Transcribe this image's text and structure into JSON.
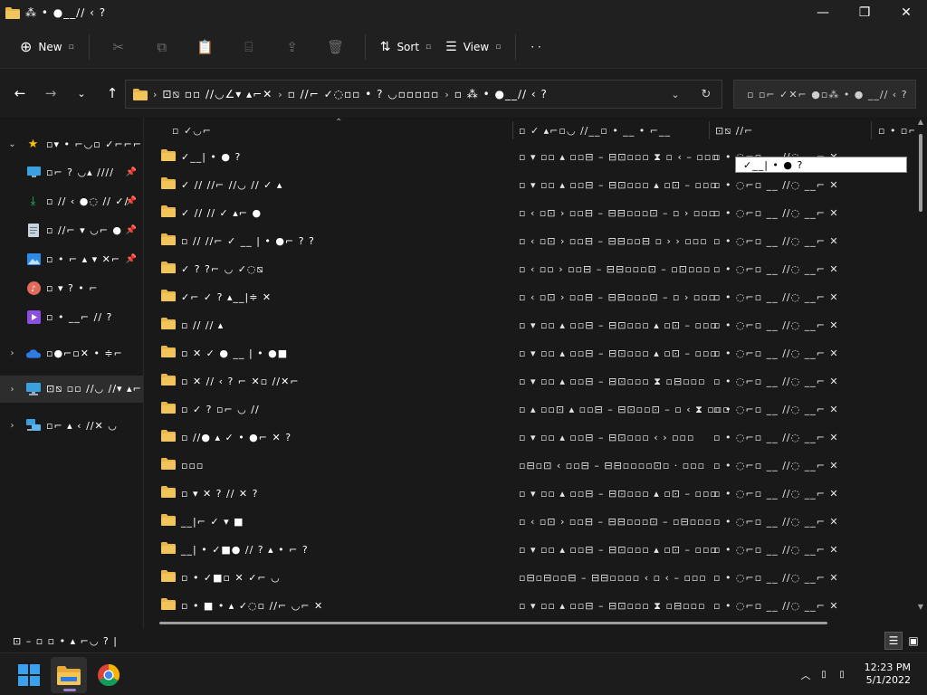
{
  "window": {
    "title": "⁂ • ●__∕∕ ‹ ?",
    "controls": {
      "minimize": "—",
      "maximize": "❐",
      "close": "✕"
    }
  },
  "commandbar": {
    "new_label": "New",
    "sort_label": "Sort",
    "view_label": "View",
    "more_label": "· ·"
  },
  "address": {
    "crumbs": [
      "⊡⧅ ▫▫ ∕∕◡∠▾ ▴⌐✕",
      "▫ ∕∕⌐ ✓◌▫▫ • ? ◡▫▫▫▫▫",
      "▫ ⁂ • ●__∕∕ ‹ ?"
    ],
    "search_placeholder": "▫  ▫⌐ ✓✕⌐ ●▫⁂ • ● __∕∕ ‹ ?"
  },
  "nav": {
    "items": [
      {
        "label": "▫▾ • ⌐◡▫ ✓⌐⌐⌐",
        "icon": "star-icon",
        "chevron": "expanded",
        "pinned": false,
        "selected": false
      },
      {
        "label": "▫⌐ ? ◡▴ ∕∕∕∕",
        "icon": "desktop-icon",
        "chevron": "",
        "pinned": true,
        "selected": false
      },
      {
        "label": "▫ ∕∕ ‹ ●◌ ∕∕ ✓∕",
        "icon": "download-icon",
        "chevron": "",
        "pinned": true,
        "selected": false
      },
      {
        "label": "▫ ∕∕⌐ ▾ ◡⌐ ●",
        "icon": "document-icon",
        "chevron": "",
        "pinned": true,
        "selected": false
      },
      {
        "label": "▫ • ⌐ ▴ ▾ ✕⌐",
        "icon": "pictures-icon",
        "chevron": "",
        "pinned": true,
        "selected": false
      },
      {
        "label": "▫ ▾ ? • ⌐",
        "icon": "music-icon",
        "chevron": "",
        "pinned": false,
        "selected": false
      },
      {
        "label": "▫ • __⌐ ∕∕ ?",
        "icon": "videos-icon",
        "chevron": "",
        "pinned": false,
        "selected": false
      },
      {
        "label": "▫●⌐▫✕ • ≑⌐",
        "icon": "onedrive-icon",
        "chevron": "collapsed",
        "pinned": false,
        "selected": false
      },
      {
        "label": "⊡⧅ ▫▫ ∕∕◡ ∕∕▾ ▴⌐",
        "icon": "this-pc-icon",
        "chevron": "collapsed",
        "pinned": false,
        "selected": true
      },
      {
        "label": "▫⌐ ▴ ‹ ∕∕✕ ◡",
        "icon": "network-icon",
        "chevron": "collapsed",
        "pinned": false,
        "selected": false
      }
    ]
  },
  "columns": {
    "name": "▫ ✓◡⌐",
    "date": "▫ ✓ ▴⌐▫◡ ∕∕__▫ • __ • ⌐__",
    "type": "⊡⧅ ∕∕⌐",
    "size": "▫ • ▫⌐"
  },
  "files": [
    {
      "name": "✓__| • ● ?",
      "date": "▫ ▾ ▫▫ ▴ ▫▫⊟ – ⊟⊡▫▫▫ ⧗ ▫ ‹ – ▫▫▫",
      "type": "▫ • ◌⌐▫ __ ∕∕◌ __⌐ ✕"
    },
    {
      "name": "✓ ∕∕ ∕∕⌐ ∕∕◡ ∕∕ ✓ ▴",
      "date": "▫ ▾ ▫▫ ▴ ▫▫⊟ – ⊟⊡▫▫▫ ▴ ▫⊡ – ▫▫▫",
      "type": "▫ • ◌⌐▫ __ ∕∕◌ __⌐ ✕"
    },
    {
      "name": "✓ ∕∕ ∕∕ ✓ ▴⌐ ●",
      "date": "▫ ‹ ▫⊡ › ▫▫⊟ – ⊟⊟▫▫▫⊡ – ▫ › ▫▫▫",
      "type": "▫ • ◌⌐▫ __ ∕∕◌ __⌐ ✕"
    },
    {
      "name": "▫ ∕∕ ∕∕⌐ ✓ __ | • ●⌐ ? ?",
      "date": "▫ ‹ ▫⊡ › ▫▫⊟ – ⊟⊟▫▫⊟ ▫ › › ▫▫▫",
      "type": "▫ • ◌⌐▫ __ ∕∕◌ __⌐ ✕"
    },
    {
      "name": "✓ ? ?⌐ ◡ ✓◌⧅",
      "date": "▫ ‹ ▫▫ › ▫▫⊟ – ⊟⊟▫▫▫⊡ – ▫⊡▫▫▫",
      "type": "▫ • ◌⌐▫ __ ∕∕◌ __⌐ ✕"
    },
    {
      "name": "✓⌐ ✓ ? ▴__|≑ ✕",
      "date": "▫ ‹ ▫⊡ › ▫▫⊟ – ⊟⊟▫▫▫⊡ – ▫ › ▫▫▫",
      "type": "▫ • ◌⌐▫ __ ∕∕◌ __⌐ ✕"
    },
    {
      "name": "▫ ∕∕ ∕∕ ▴",
      "date": "▫ ▾ ▫▫ ▴ ▫▫⊟ – ⊟⊡▫▫▫ ▴ ▫⊡ – ▫▫▫",
      "type": "▫ • ◌⌐▫ __ ∕∕◌ __⌐ ✕"
    },
    {
      "name": "▫ ✕ ✓ ● __ | • ●■",
      "date": "▫ ▾ ▫▫ ▴ ▫▫⊟ – ⊟⊡▫▫▫ ▴ ▫⊡ – ▫▫▫",
      "type": "▫ • ◌⌐▫ __ ∕∕◌ __⌐ ✕"
    },
    {
      "name": "▫ ✕ ∕∕ ‹ ? ⌐ ✕▫ ∕∕✕⌐",
      "date": "▫ ▾ ▫▫ ▴ ▫▫⊟ – ⊟⊡▫▫▫ ⧗ ▫⊟▫▫▫",
      "type": "▫ • ◌⌐▫ __ ∕∕◌ __⌐ ✕"
    },
    {
      "name": "▫ ✓ ? ▫⌐ ◡ ∕∕",
      "date": "▫ ▴ ▫▫⊡ ▴ ▫▫⊟ – ⊟⊡▫▫⊡ – ▫ ‹ ⧗ ▫▫▫",
      "type": "▫ • ◌⌐▫ __ ∕∕◌ __⌐ ✕"
    },
    {
      "name": "▫ ∕∕● ▴ ✓ • ●⌐ ✕ ?",
      "date": "▫ ▾ ▫▫ ▴ ▫▫⊟ – ⊟⊡▫▫▫ ‹ › ▫▫▫",
      "type": "▫ • ◌⌐▫ __ ∕∕◌ __⌐ ✕"
    },
    {
      "name": "▫▫▫",
      "date": "▫⊟▫⊡ ‹ ▫▫⊟ – ⊟⊟▫▫▫▫⊡▫ · ▫▫▫",
      "type": "▫ • ◌⌐▫ __ ∕∕◌ __⌐ ✕"
    },
    {
      "name": "▫ ▾ ✕ ? ∕∕ ✕ ?",
      "date": "▫ ▾ ▫▫ ▴ ▫▫⊟ – ⊟⊡▫▫▫ ▴ ▫⊡ – ▫▫▫",
      "type": "▫ • ◌⌐▫ __ ∕∕◌ __⌐ ✕"
    },
    {
      "name": "__|⌐ ✓ ▾ ■",
      "date": "▫ ‹ ▫⊡ › ▫▫⊟ – ⊟⊟▫▫▫⊡ – ▫⊟▫▫▫",
      "type": "▫ • ◌⌐▫ __ ∕∕◌ __⌐ ✕"
    },
    {
      "name": "__| • ✓■● ∕∕ ? ▴ • ⌐ ?",
      "date": "▫ ▾ ▫▫ ▴ ▫▫⊟ – ⊟⊡▫▫▫ ▴ ▫⊡ – ▫▫▫",
      "type": "▫ • ◌⌐▫ __ ∕∕◌ __⌐ ✕"
    },
    {
      "name": "▫ • ✓■▫ ✕ ✓⌐ ◡",
      "date": "▫⊟▫⊟▫▫⊟ – ⊟⊟▫▫▫▫ ‹ ▫ ‹ – ▫▫▫",
      "type": "▫ • ◌⌐▫ __ ∕∕◌ __⌐ ✕"
    },
    {
      "name": "▫ • ■ • ▴ ✓◌▫ ∕∕⌐ ◡⌐ ✕",
      "date": "▫ ▾ ▫▫ ▴ ▫▫⊟ – ⊟⊡▫▫▫ ⧗ ▫⊟▫▫▫",
      "type": "▫ • ◌⌐▫ __ ∕∕◌ __⌐ ✕"
    }
  ],
  "tooltip": "✓__| • ● ?",
  "status": {
    "text": "⊡ – ▫ ▫ • ▴ ⌐◡ ?  |"
  },
  "taskbar": {
    "apps": [
      {
        "name": "start",
        "active": false
      },
      {
        "name": "file-explorer",
        "active": true
      },
      {
        "name": "chrome",
        "active": false
      }
    ],
    "time": "12:23 PM",
    "date": "5/1/2022"
  },
  "colors": {
    "background": "#191919",
    "folder": "#e8b64a",
    "accent": "#9a82c8",
    "star": "#f4c400",
    "onedrive": "#2d7be4"
  }
}
